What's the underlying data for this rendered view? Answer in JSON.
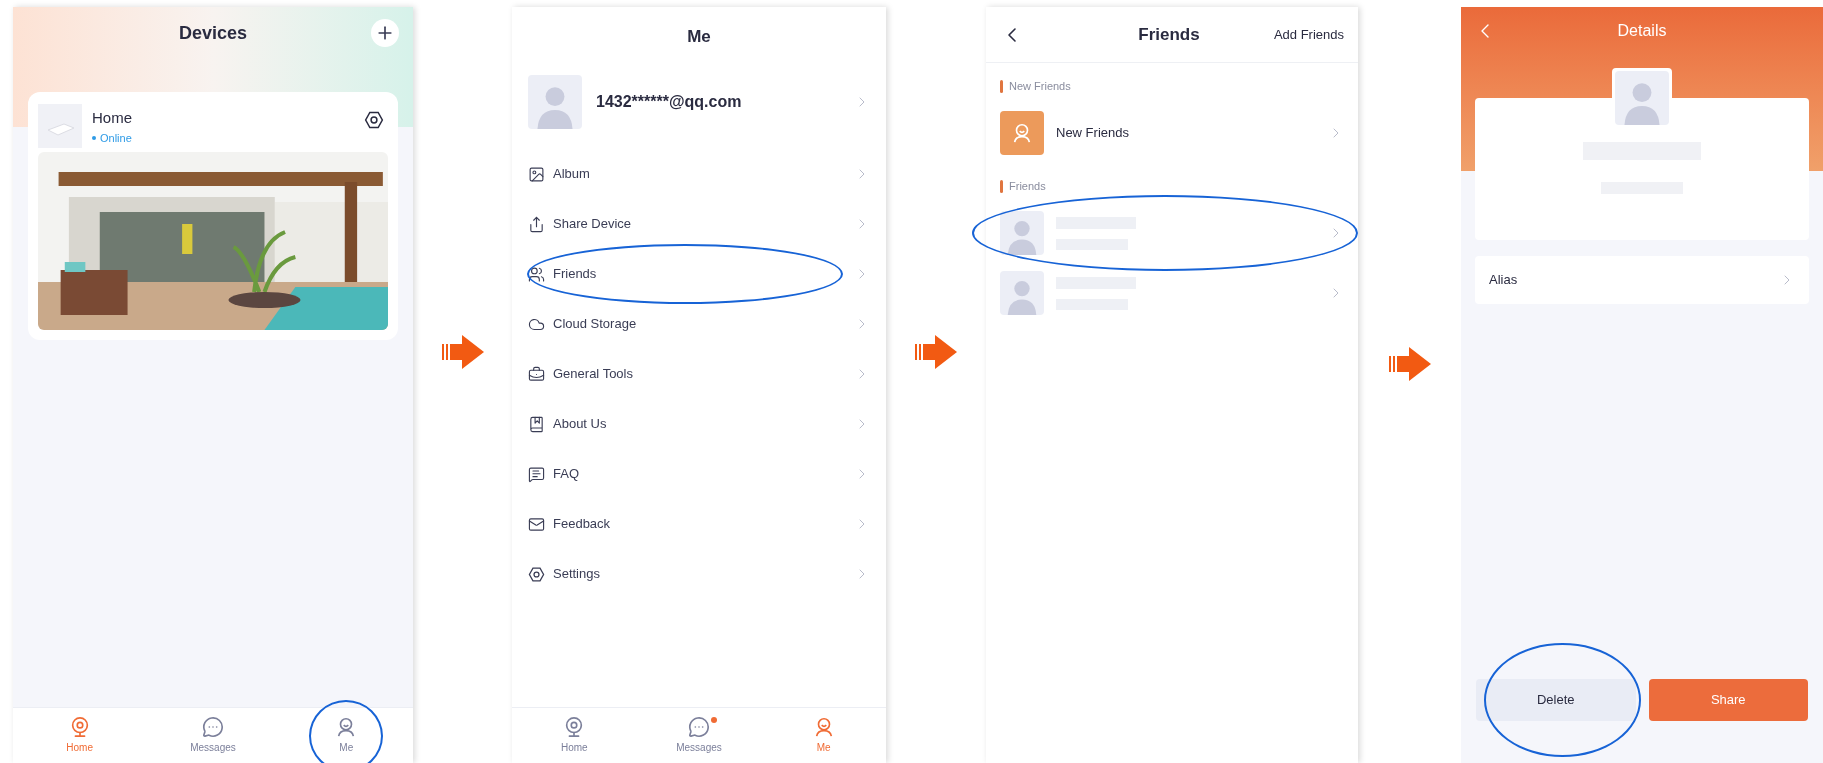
{
  "screens": [
    {
      "kind": "devices",
      "title": "Devices",
      "device": {
        "name": "Home",
        "status": "Online",
        "online": true
      },
      "tabs": [
        {
          "label": "Home",
          "selected": true,
          "badge": false,
          "annotated": false
        },
        {
          "label": "Messages",
          "selected": false,
          "badge": false,
          "annotated": false
        },
        {
          "label": "Me",
          "selected": false,
          "badge": false,
          "annotated": true
        }
      ]
    },
    {
      "kind": "me",
      "title": "Me",
      "account": "1432******@qq.com",
      "items": [
        {
          "label": "Album",
          "annotated": false
        },
        {
          "label": "Share Device",
          "annotated": false
        },
        {
          "label": "Friends",
          "annotated": true
        },
        {
          "label": "Cloud Storage",
          "annotated": false
        },
        {
          "label": "General Tools",
          "annotated": false
        },
        {
          "label": "About Us",
          "annotated": false
        },
        {
          "label": "FAQ",
          "annotated": false
        },
        {
          "label": "Feedback",
          "annotated": false
        },
        {
          "label": "Settings",
          "annotated": false
        }
      ],
      "tabs": [
        {
          "label": "Home",
          "selected": false,
          "badge": false,
          "annotated": false
        },
        {
          "label": "Messages",
          "selected": false,
          "badge": true,
          "annotated": false
        },
        {
          "label": "Me",
          "selected": true,
          "badge": false,
          "annotated": false
        }
      ]
    },
    {
      "kind": "friends",
      "title": "Friends",
      "action": "Add Friends",
      "sections": [
        {
          "title": "New Friends",
          "rows": [
            {
              "kind": "request",
              "label": "New Friends",
              "annotated": false
            }
          ]
        },
        {
          "title": "Friends",
          "rows": [
            {
              "kind": "hidden",
              "annotated": true
            },
            {
              "kind": "hidden",
              "annotated": false
            }
          ]
        }
      ]
    },
    {
      "kind": "details",
      "title": "Details",
      "rows": [
        {
          "label": "Alias"
        }
      ],
      "buttons": [
        {
          "label": "Delete",
          "kind": "secondary",
          "annotated": true
        },
        {
          "label": "Share",
          "kind": "primary",
          "annotated": false
        }
      ]
    }
  ]
}
